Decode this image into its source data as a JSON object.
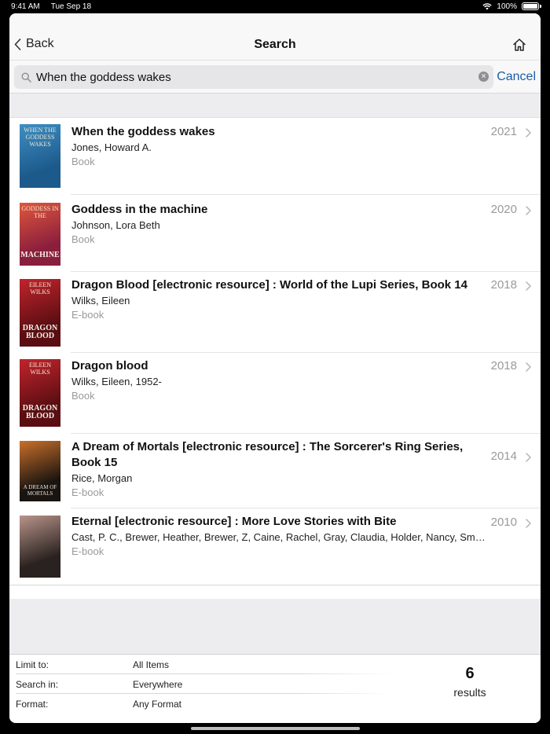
{
  "status": {
    "time": "9:41 AM",
    "date": "Tue Sep 18",
    "battery": "100%"
  },
  "nav": {
    "back_label": "Back",
    "title": "Search"
  },
  "search": {
    "value": "When the goddess wakes",
    "cancel_label": "Cancel"
  },
  "results": [
    {
      "title": "When the goddess wakes",
      "author": "Jones, Howard A.",
      "format": "Book",
      "year": "2021",
      "cover": {
        "top": "WHEN THE GODDESS WAKES",
        "bottom": "",
        "bg": "#1d5a8c",
        "accent": "#3e8fc4"
      }
    },
    {
      "title": "Goddess in the machine",
      "author": "Johnson, Lora Beth",
      "format": "Book",
      "year": "2020",
      "cover": {
        "top": "GODDESS IN THE",
        "bottom": "MACHINE",
        "bg": "#8a1f3d",
        "accent": "#e0563c"
      }
    },
    {
      "title": "Dragon Blood [electronic resource] : World of the Lupi Series, Book 14",
      "author": "Wilks, Eileen",
      "format": "E-book",
      "year": "2018",
      "cover": {
        "top": "EILEEN WILKS",
        "bottom": "DRAGON BLOOD",
        "bg": "#5a0e12",
        "accent": "#c2242c"
      }
    },
    {
      "title": "Dragon blood",
      "author": "Wilks, Eileen, 1952-",
      "format": "Book",
      "year": "2018",
      "cover": {
        "top": "EILEEN WILKS",
        "bottom": "DRAGON BLOOD",
        "bg": "#5a0e12",
        "accent": "#c2242c"
      }
    },
    {
      "title": "A Dream of Mortals [electronic resource] : The Sorcerer's Ring Series, Book 15",
      "author": "Rice, Morgan",
      "format": "E-book",
      "year": "2014",
      "cover": {
        "top": "",
        "bottom": "A DREAM OF MORTALS",
        "bg": "#1a1410",
        "accent": "#c9702a"
      }
    },
    {
      "title": "Eternal [electronic resource] : More Love Stories with Bite",
      "author": "Cast, P. C., Brewer, Heather, Brewer, Z, Caine, Rachel, Gray, Claudia, Holder, Nancy, Smith-Ready, Jeri",
      "format": "E-book",
      "year": "2010",
      "cover": {
        "top": "",
        "bottom": "",
        "bg": "#2a2220",
        "accent": "#b8948a"
      }
    }
  ],
  "filters": [
    {
      "label": "Limit to:",
      "value": "All Items"
    },
    {
      "label": "Search in:",
      "value": "Everywhere"
    },
    {
      "label": "Format:",
      "value": "Any Format"
    }
  ],
  "count": {
    "number": "6",
    "label": "results"
  }
}
